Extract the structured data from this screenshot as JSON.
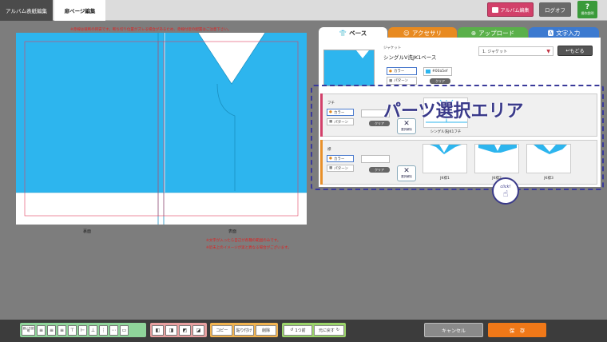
{
  "topbar": {
    "tab_album_cover": "アルバム表紙編集",
    "tab_page_edit": "扉ページ編集",
    "album_edit_label": "アルバム編集",
    "logoff_label": "ログオフ",
    "help_label": "操作説明",
    "help_mark": "?"
  },
  "canvas": {
    "top_warning": "※赤線は裁断の目安です。断ち切り位置がズレる場合があるため、赤線付近の配置はご注意下さい。",
    "label_back": "裏面",
    "label_front": "表面",
    "note_1": "※文字が入ったら自己が各種の範囲のみです。",
    "note_2": "※近未上のイメージが実と異なる場合がございます。"
  },
  "tabs": {
    "base": "ベース",
    "accessory": "アクセサリ",
    "upload": "アップロード",
    "text_input": "文字入力"
  },
  "base_panel": {
    "category": "ジャケット",
    "item_name": "シングルV洗JK1ベース",
    "select_value": "1. ジャケット",
    "back_button": "もどる",
    "color_label": "カラー",
    "pattern_label": "パターン",
    "color_value": "#00a5ef",
    "clear_label": "クリア"
  },
  "rows": [
    {
      "label": "フチ",
      "color_label": "カラー",
      "pattern_label": "パターン",
      "clear_label": "クリア",
      "deselect_label": "選択解除",
      "thumbs": [
        "シングル洗JK1フチ"
      ]
    },
    {
      "label": "襟",
      "color_label": "カラー",
      "pattern_label": "パターン",
      "clear_label": "クリア",
      "deselect_label": "選択解除",
      "thumbs": [
        "JK襟1",
        "JK襟2",
        "JK襟3"
      ]
    }
  ],
  "overlay": {
    "title": "パーツ選択エリア",
    "stamp": "click!"
  },
  "toolbar": {
    "align_label": "揃い方説明",
    "copy_label": "コピー",
    "paste_label": "貼り付け",
    "delete_label": "削除",
    "undo_label": "1つ前",
    "redo_label": "元に戻す"
  },
  "footer": {
    "cancel_label": "キャンセル",
    "save_label": "保　存"
  },
  "colors": {
    "jacket_blue": "#2db5ee",
    "accent_pink": "#d2406a",
    "save_orange": "#f07818"
  }
}
